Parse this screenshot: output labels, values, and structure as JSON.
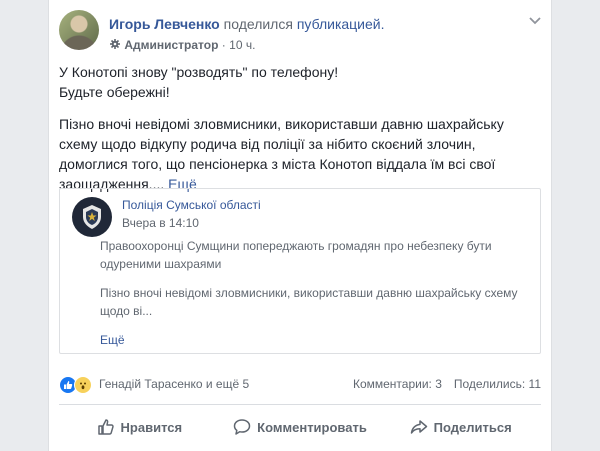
{
  "post": {
    "author": "Игорь Левченко",
    "shared_verb": "поделился",
    "shared_object": "публикацией.",
    "role": "Администратор",
    "meta_separator": "·",
    "time": "10 ч.",
    "headline_1": "У Конотопі знову \"розводять\" по телефону!",
    "headline_2": "Будьте обережні!",
    "body": "Пізно вночі невідомі зловмисники, використавши давню шахрайську схему щодо відкупу родича від поліції за нібито скоєний злочин, домоглися того, що пенсіонерка з міста Конотоп віддала їм всі свої заощадження.",
    "ellipsis": "...",
    "more": "Ещё"
  },
  "shared": {
    "page_name": "Поліція Сумської області",
    "time": "Вчера в 14:10",
    "text_1": "Правоохоронці Сумщини попереджають громадян про небезпеку бути одуреними шахраями",
    "text_2": "Пізно вночі невідомі зловмисники, використавши давню шахрайську схему щодо ві...",
    "more": "Ещё"
  },
  "reactions": {
    "icons": [
      "like-icon",
      "wow-icon"
    ],
    "reactors": "Генадій Тарасенко и ещё 5",
    "comments": "Комментарии: 3",
    "shares": "Поделились: 11"
  },
  "actions": {
    "like": "Нравится",
    "comment": "Комментировать",
    "share": "Поделиться"
  },
  "colors": {
    "link": "#365899",
    "secondary_text": "#606770",
    "like_blue": "#1877f2"
  }
}
